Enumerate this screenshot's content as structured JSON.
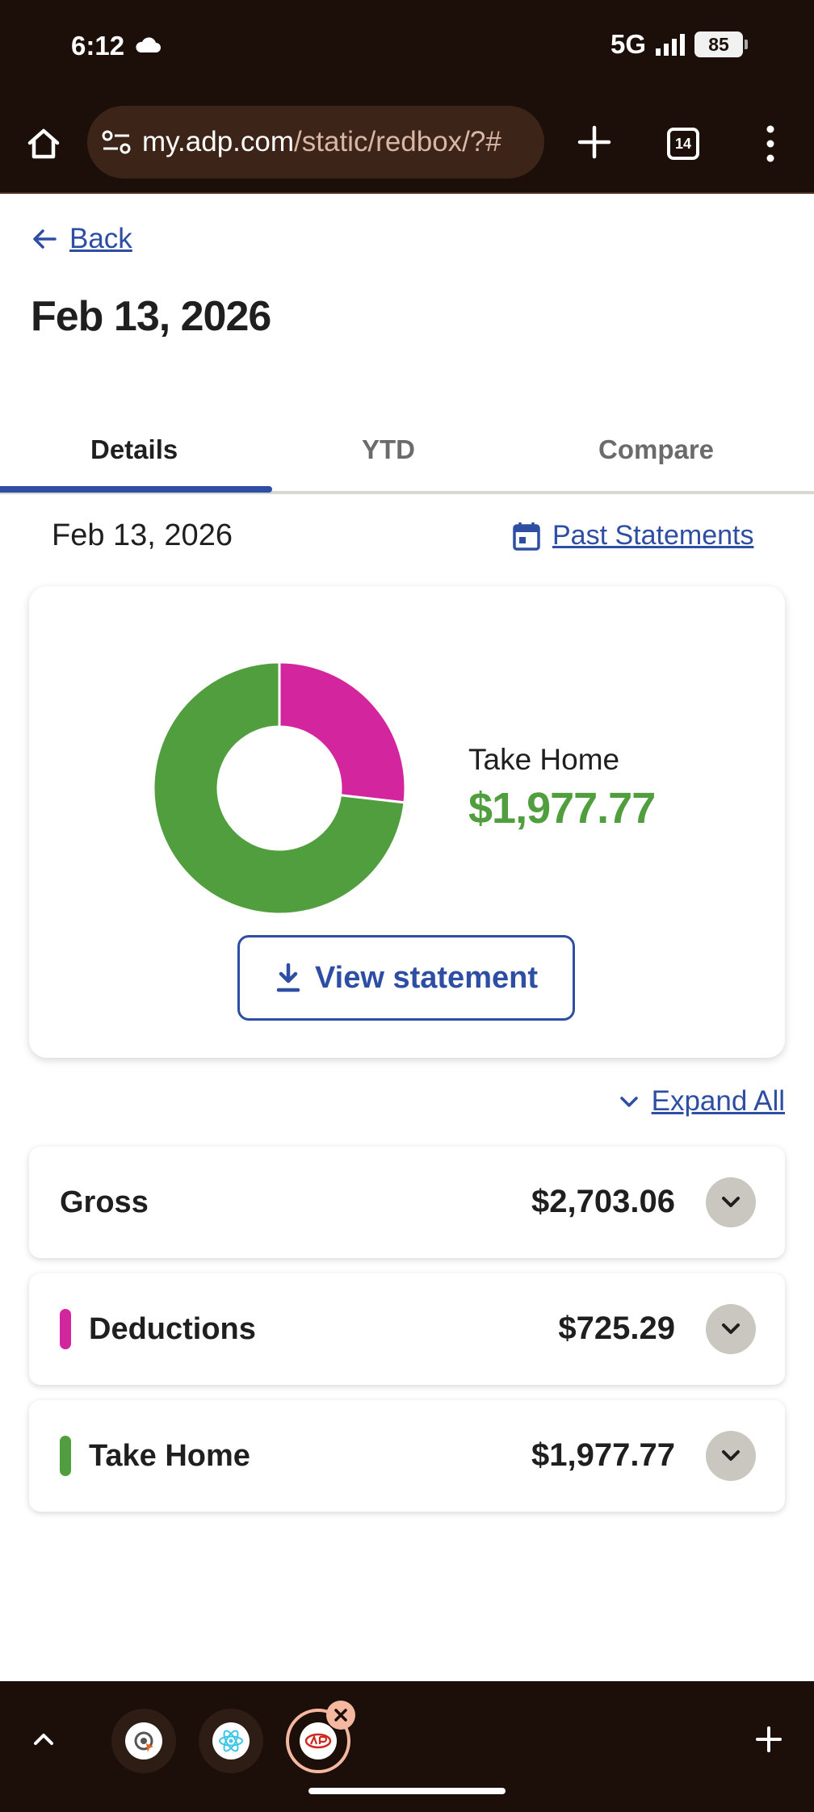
{
  "status_bar": {
    "time": "6:12",
    "network": "5G",
    "battery": "85"
  },
  "browser": {
    "url_host": "my.adp.com",
    "url_path": "/static/redbox/?#",
    "tab_count": "14"
  },
  "page": {
    "back_label": "Back",
    "title": "Feb 13, 2026",
    "tabs": [
      {
        "label": "Details",
        "active": true
      },
      {
        "label": "YTD",
        "active": false
      },
      {
        "label": "Compare",
        "active": false
      }
    ],
    "statement_date": "Feb 13, 2026",
    "past_statements_label": "Past Statements",
    "summary": {
      "take_home_label": "Take Home",
      "take_home_amount": "$1,977.77",
      "view_statement_label": "View statement"
    },
    "expand_all_label": "Expand All",
    "rows": [
      {
        "name": "Gross",
        "amount": "$2,703.06",
        "color": ""
      },
      {
        "name": "Deductions",
        "amount": "$725.29",
        "color": "#d3269e"
      },
      {
        "name": "Take Home",
        "amount": "$1,977.77",
        "color": "#519e3f"
      }
    ]
  },
  "colors": {
    "accent": "#2e4ea3",
    "deductions": "#d3269e",
    "take_home": "#519e3f",
    "chrome": "#1c0f0a"
  },
  "chart_data": {
    "type": "pie",
    "slices": [
      {
        "label": "Deductions",
        "value": 725.29,
        "color": "#d3269e"
      },
      {
        "label": "Take Home",
        "value": 1977.77,
        "color": "#519e3f"
      }
    ]
  }
}
